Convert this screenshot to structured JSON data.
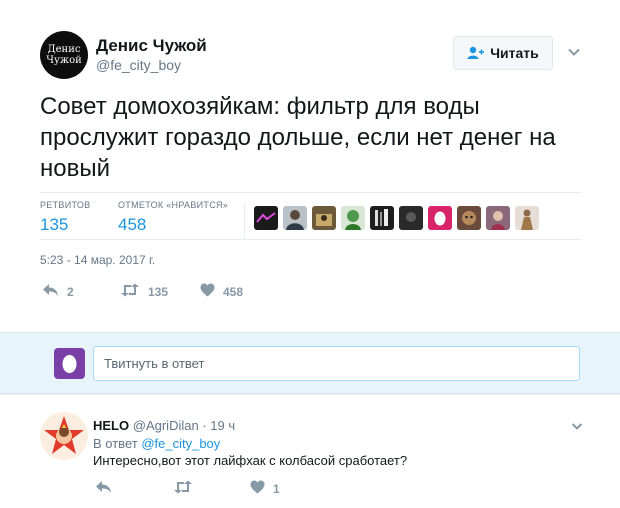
{
  "tweet": {
    "author": {
      "name": "Денис Чужой",
      "handle": "@fe_city_boy",
      "avatar_line1": "Денис",
      "avatar_line2": "Чужой"
    },
    "follow_label": "Читать",
    "text": "Совет домохозяйкам: фильтр для воды прослужит гораздо дольше, если нет денег на новый",
    "retweets": {
      "label": "РЕТВИТОВ",
      "value": "135"
    },
    "likes": {
      "label": "ОТМЕТОК «НРАВИТСЯ»",
      "value": "458"
    },
    "likers": [
      {
        "icon": "liker-logo",
        "color": "#1a1a1a"
      },
      {
        "icon": "liker-man",
        "color": "#6b6f72"
      },
      {
        "icon": "liker-photo",
        "color": "#8a6a3a"
      },
      {
        "icon": "liker-frog",
        "color": "#bcd7b8"
      },
      {
        "icon": "liker-glitch",
        "color": "#222222"
      },
      {
        "icon": "liker-dark",
        "color": "#3a3a3a"
      },
      {
        "icon": "liker-egg",
        "color": "#d7246b"
      },
      {
        "icon": "liker-cat",
        "color": "#6a4a3a"
      },
      {
        "icon": "liker-girl",
        "color": "#7a5a6a"
      },
      {
        "icon": "liker-figure",
        "color": "#a09080"
      }
    ],
    "timestamp": "5:23 - 14 мар. 2017 г.",
    "actions": {
      "replies": "2",
      "retweets": "135",
      "likes": "458"
    }
  },
  "reply_box": {
    "placeholder": "Твитнуть в ответ"
  },
  "comment": {
    "name": "HELO",
    "handle": "@AgriDilan",
    "separator": "·",
    "time": "19 ч",
    "reply_prefix": "В ответ",
    "reply_to": "@fe_city_boy",
    "text": "Интересно,вот этот лайфхак  с колбасой сработает?",
    "likes": "1"
  },
  "colors": {
    "accent": "#1b95e0",
    "muted": "#657786",
    "reply_bg": "#e8f4fb"
  }
}
